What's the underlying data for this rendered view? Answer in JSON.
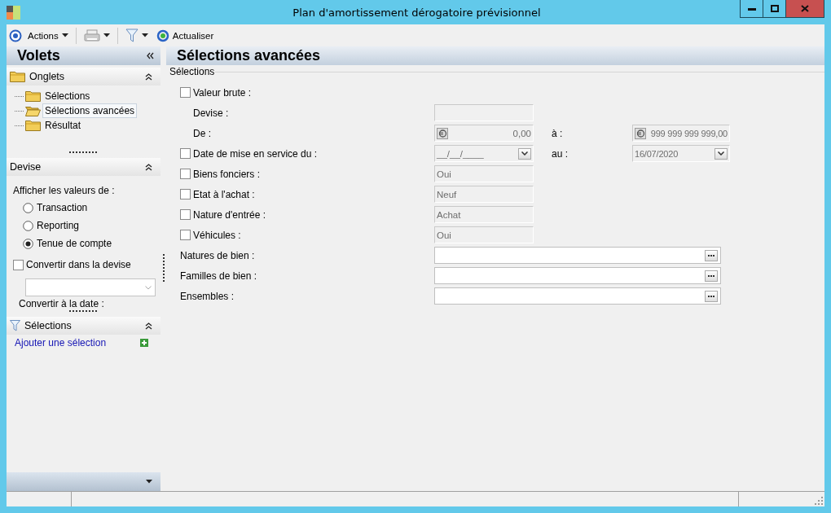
{
  "window": {
    "title": "Plan d'amortissement dérogatoire prévisionnel"
  },
  "toolbar": {
    "actions_label": "Actions",
    "refresh_label": "Actualiser"
  },
  "sidebar": {
    "title": "Volets",
    "tabs_panel": {
      "title": "Onglets",
      "items": [
        {
          "label": "Sélections",
          "selected": false
        },
        {
          "label": "Sélections avancées",
          "selected": true
        },
        {
          "label": "Résultat",
          "selected": false
        }
      ]
    },
    "currency_panel": {
      "title": "Devise",
      "prompt": "Afficher les valeurs de :",
      "options": [
        {
          "label": "Transaction",
          "selected": false
        },
        {
          "label": "Reporting",
          "selected": false
        },
        {
          "label": "Tenue de compte",
          "selected": true
        }
      ],
      "convert": {
        "label": "Convertir dans la devise",
        "checked": false
      },
      "convert_date_label": "Convertir à la date :"
    },
    "selections_panel": {
      "title": "Sélections",
      "add_link": "Ajouter une sélection"
    }
  },
  "main": {
    "title": "Sélections avancées",
    "group_title": "Sélections",
    "rows": [
      {
        "kind": "check",
        "label": "Valeur brute :",
        "checked": false
      },
      {
        "kind": "text",
        "label": "Devise :"
      },
      {
        "kind": "amount-range",
        "label": "De :",
        "from": "0,00",
        "to_label": "à :",
        "to": "999 999 999 999,00"
      },
      {
        "kind": "date-range",
        "label": "Date de mise en service du :",
        "checked": false,
        "from": "__/__/____",
        "to_label": "au :",
        "to": "16/07/2020"
      },
      {
        "kind": "check-value",
        "label": "Biens fonciers :",
        "checked": false,
        "value": "Oui"
      },
      {
        "kind": "check-value",
        "label": "Etat à l'achat :",
        "checked": false,
        "value": "Neuf"
      },
      {
        "kind": "check-value",
        "label": "Nature d'entrée :",
        "checked": false,
        "value": "Achat"
      },
      {
        "kind": "check-value",
        "label": "Véhicules :",
        "checked": false,
        "value": "Oui"
      },
      {
        "kind": "picker",
        "label": "Natures de bien :"
      },
      {
        "kind": "picker",
        "label": "Familles de bien :"
      },
      {
        "kind": "picker",
        "label": "Ensembles :"
      }
    ]
  }
}
